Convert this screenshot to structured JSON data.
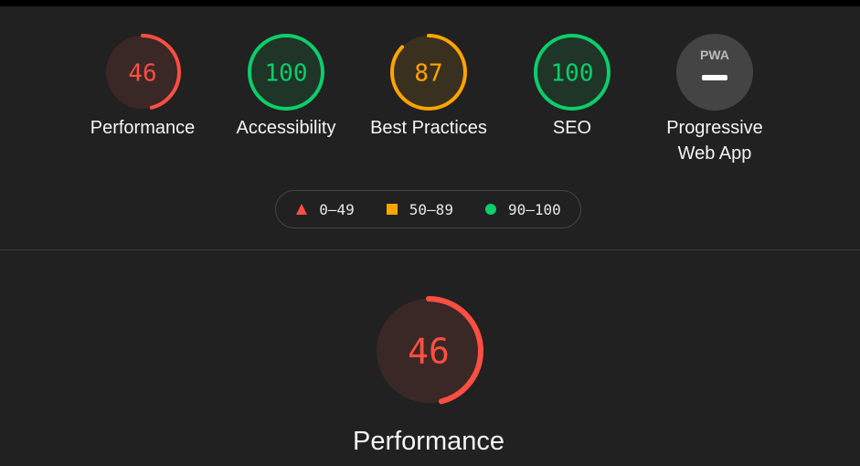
{
  "colors": {
    "fail": "#ff4e42",
    "average": "#ffa400",
    "pass": "#0cce6b",
    "na": "#444444"
  },
  "categories": [
    {
      "label": "Performance",
      "score": 46,
      "rating": "fail"
    },
    {
      "label": "Accessibility",
      "score": 100,
      "rating": "pass"
    },
    {
      "label": "Best Practices",
      "score": 87,
      "rating": "average"
    },
    {
      "label": "SEO",
      "score": 100,
      "rating": "pass"
    },
    {
      "label": "Progressive Web App",
      "label_line1": "Progressive",
      "label_line2": "Web App",
      "badge": "PWA",
      "icon": "pwa-dash-icon"
    }
  ],
  "legend": [
    {
      "range": "0–49",
      "shape": "triangle",
      "rating": "fail"
    },
    {
      "range": "50–89",
      "shape": "square",
      "rating": "average"
    },
    {
      "range": "90–100",
      "shape": "circle",
      "rating": "pass"
    }
  ],
  "main": {
    "label": "Performance",
    "score": 46,
    "rating": "fail"
  }
}
